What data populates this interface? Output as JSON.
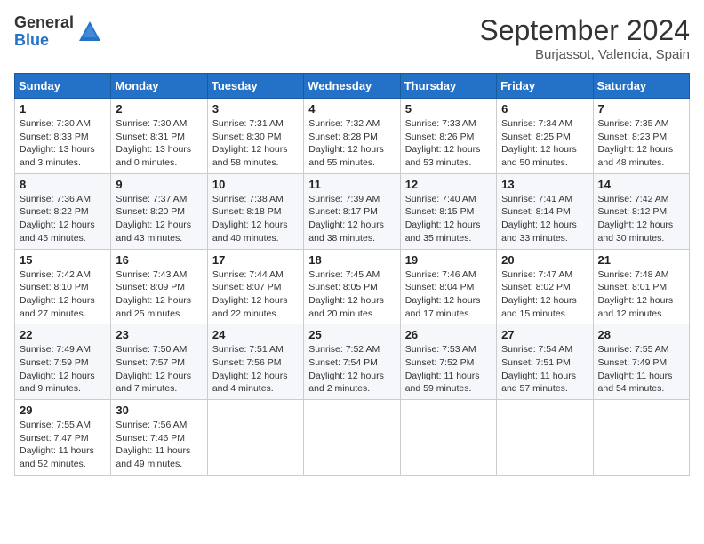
{
  "header": {
    "logo_general": "General",
    "logo_blue": "Blue",
    "month_year": "September 2024",
    "location": "Burjassot, Valencia, Spain"
  },
  "calendar": {
    "days_of_week": [
      "Sunday",
      "Monday",
      "Tuesday",
      "Wednesday",
      "Thursday",
      "Friday",
      "Saturday"
    ],
    "weeks": [
      [
        null,
        null,
        null,
        null,
        null,
        null,
        null
      ]
    ],
    "cells": [
      {
        "day": 1,
        "col": 0,
        "sunrise": "7:30 AM",
        "sunset": "8:33 PM",
        "daylight": "13 hours and 3 minutes."
      },
      {
        "day": 2,
        "col": 1,
        "sunrise": "7:30 AM",
        "sunset": "8:31 PM",
        "daylight": "13 hours and 0 minutes."
      },
      {
        "day": 3,
        "col": 2,
        "sunrise": "7:31 AM",
        "sunset": "8:30 PM",
        "daylight": "12 hours and 58 minutes."
      },
      {
        "day": 4,
        "col": 3,
        "sunrise": "7:32 AM",
        "sunset": "8:28 PM",
        "daylight": "12 hours and 55 minutes."
      },
      {
        "day": 5,
        "col": 4,
        "sunrise": "7:33 AM",
        "sunset": "8:26 PM",
        "daylight": "12 hours and 53 minutes."
      },
      {
        "day": 6,
        "col": 5,
        "sunrise": "7:34 AM",
        "sunset": "8:25 PM",
        "daylight": "12 hours and 50 minutes."
      },
      {
        "day": 7,
        "col": 6,
        "sunrise": "7:35 AM",
        "sunset": "8:23 PM",
        "daylight": "12 hours and 48 minutes."
      },
      {
        "day": 8,
        "col": 0,
        "sunrise": "7:36 AM",
        "sunset": "8:22 PM",
        "daylight": "12 hours and 45 minutes."
      },
      {
        "day": 9,
        "col": 1,
        "sunrise": "7:37 AM",
        "sunset": "8:20 PM",
        "daylight": "12 hours and 43 minutes."
      },
      {
        "day": 10,
        "col": 2,
        "sunrise": "7:38 AM",
        "sunset": "8:18 PM",
        "daylight": "12 hours and 40 minutes."
      },
      {
        "day": 11,
        "col": 3,
        "sunrise": "7:39 AM",
        "sunset": "8:17 PM",
        "daylight": "12 hours and 38 minutes."
      },
      {
        "day": 12,
        "col": 4,
        "sunrise": "7:40 AM",
        "sunset": "8:15 PM",
        "daylight": "12 hours and 35 minutes."
      },
      {
        "day": 13,
        "col": 5,
        "sunrise": "7:41 AM",
        "sunset": "8:14 PM",
        "daylight": "12 hours and 33 minutes."
      },
      {
        "day": 14,
        "col": 6,
        "sunrise": "7:42 AM",
        "sunset": "8:12 PM",
        "daylight": "12 hours and 30 minutes."
      },
      {
        "day": 15,
        "col": 0,
        "sunrise": "7:42 AM",
        "sunset": "8:10 PM",
        "daylight": "12 hours and 27 minutes."
      },
      {
        "day": 16,
        "col": 1,
        "sunrise": "7:43 AM",
        "sunset": "8:09 PM",
        "daylight": "12 hours and 25 minutes."
      },
      {
        "day": 17,
        "col": 2,
        "sunrise": "7:44 AM",
        "sunset": "8:07 PM",
        "daylight": "12 hours and 22 minutes."
      },
      {
        "day": 18,
        "col": 3,
        "sunrise": "7:45 AM",
        "sunset": "8:05 PM",
        "daylight": "12 hours and 20 minutes."
      },
      {
        "day": 19,
        "col": 4,
        "sunrise": "7:46 AM",
        "sunset": "8:04 PM",
        "daylight": "12 hours and 17 minutes."
      },
      {
        "day": 20,
        "col": 5,
        "sunrise": "7:47 AM",
        "sunset": "8:02 PM",
        "daylight": "12 hours and 15 minutes."
      },
      {
        "day": 21,
        "col": 6,
        "sunrise": "7:48 AM",
        "sunset": "8:01 PM",
        "daylight": "12 hours and 12 minutes."
      },
      {
        "day": 22,
        "col": 0,
        "sunrise": "7:49 AM",
        "sunset": "7:59 PM",
        "daylight": "12 hours and 9 minutes."
      },
      {
        "day": 23,
        "col": 1,
        "sunrise": "7:50 AM",
        "sunset": "7:57 PM",
        "daylight": "12 hours and 7 minutes."
      },
      {
        "day": 24,
        "col": 2,
        "sunrise": "7:51 AM",
        "sunset": "7:56 PM",
        "daylight": "12 hours and 4 minutes."
      },
      {
        "day": 25,
        "col": 3,
        "sunrise": "7:52 AM",
        "sunset": "7:54 PM",
        "daylight": "12 hours and 2 minutes."
      },
      {
        "day": 26,
        "col": 4,
        "sunrise": "7:53 AM",
        "sunset": "7:52 PM",
        "daylight": "11 hours and 59 minutes."
      },
      {
        "day": 27,
        "col": 5,
        "sunrise": "7:54 AM",
        "sunset": "7:51 PM",
        "daylight": "11 hours and 57 minutes."
      },
      {
        "day": 28,
        "col": 6,
        "sunrise": "7:55 AM",
        "sunset": "7:49 PM",
        "daylight": "11 hours and 54 minutes."
      },
      {
        "day": 29,
        "col": 0,
        "sunrise": "7:55 AM",
        "sunset": "7:47 PM",
        "daylight": "11 hours and 52 minutes."
      },
      {
        "day": 30,
        "col": 1,
        "sunrise": "7:56 AM",
        "sunset": "7:46 PM",
        "daylight": "11 hours and 49 minutes."
      }
    ]
  }
}
